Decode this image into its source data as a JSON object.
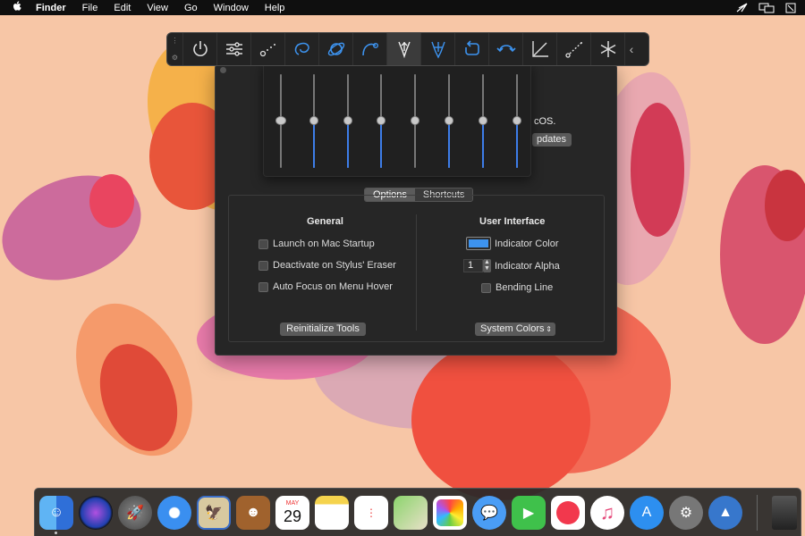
{
  "menubar": {
    "apple": "",
    "items": [
      "Finder",
      "File",
      "Edit",
      "View",
      "Go",
      "Window",
      "Help"
    ],
    "status_icons": [
      "cast-icon",
      "display-mirror-icon",
      "fullscreen-icon"
    ]
  },
  "toolbar": {
    "tools": [
      "power-icon",
      "sliders-icon",
      "dotted-line-icon",
      "lasso-icon",
      "orbit-icon",
      "arc-pen-icon",
      "tripod-pen-icon",
      "fountain-pen-icon",
      "rotate-icon",
      "undo-icon",
      "axes-icon",
      "dashed-line-icon",
      "asterisk-icon"
    ],
    "active_tool": "tripod-pen-icon",
    "collapse": "‹"
  },
  "behind": {
    "text": "cOS.",
    "button": "pdates"
  },
  "tabs": {
    "options": "Options",
    "shortcuts": "Shortcuts"
  },
  "general": {
    "heading": "General",
    "launch": "Launch on Mac Startup",
    "deactivate": "Deactivate on Stylus' Eraser",
    "autofocus": "Auto Focus on Menu Hover",
    "reinit": "Reinitialize Tools"
  },
  "ui": {
    "heading": "User Interface",
    "indicator_color_label": "Indicator Color",
    "indicator_color": "#3d93ef",
    "indicator_alpha_label": "Indicator Alpha",
    "indicator_alpha_value": "1",
    "bending_line": "Bending Line",
    "system_colors": "System Colors"
  },
  "dock": {
    "calendar_month": "MAY",
    "calendar_day": "29"
  }
}
